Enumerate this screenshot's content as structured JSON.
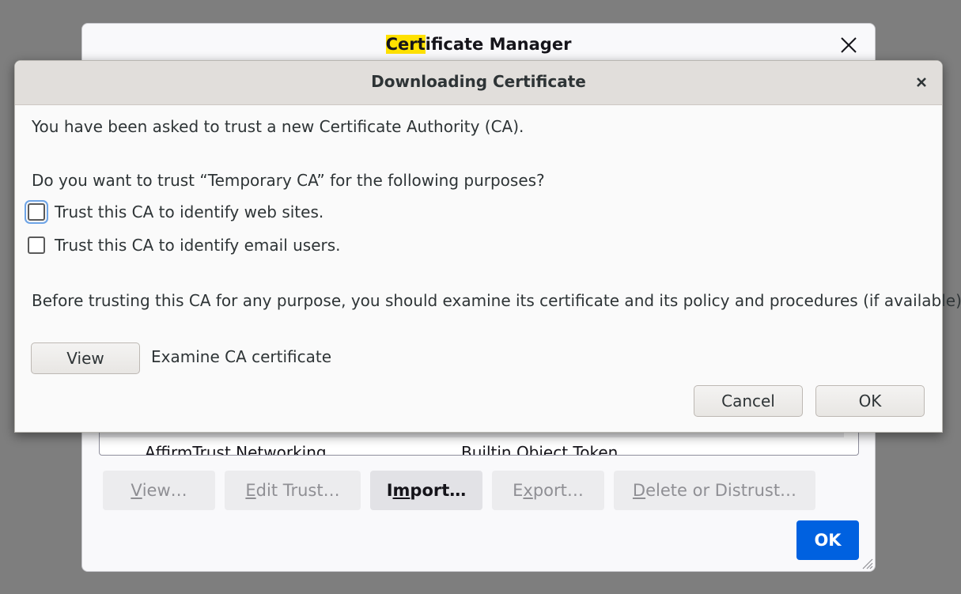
{
  "manager": {
    "title_highlight": "Cert",
    "title_rest": "ificate Manager",
    "tree_row": {
      "name": "AffirmTrust Networking",
      "token": "Builtin Object Token"
    },
    "buttons": {
      "view": {
        "mnemonic": "V",
        "rest": "iew…"
      },
      "edit_trust": {
        "mnemonic": "E",
        "rest": "dit Trust…"
      },
      "import": {
        "pre": "I",
        "mnemonic": "m",
        "rest": "port…"
      },
      "export": {
        "pre": "E",
        "mnemonic": "x",
        "rest": "port…"
      },
      "delete": {
        "mnemonic": "D",
        "rest": "elete or Distrust…"
      }
    },
    "ok_label": "OK"
  },
  "dialog": {
    "title": "Downloading Certificate",
    "intro": "You have been asked to trust a new Certificate Authority (CA).",
    "question": "Do you want to trust “Temporary CA” for the following purposes?",
    "trust_websites_label": "Trust this CA to identify web sites.",
    "trust_websites_checked": false,
    "trust_email_label": "Trust this CA to identify email users.",
    "trust_email_checked": false,
    "advice": "Before trusting this CA for any purpose, you should examine its certificate and its policy and procedures (if available).",
    "view_label": "View",
    "examine_label": "Examine CA certificate",
    "cancel_label": "Cancel",
    "ok_label": "OK"
  },
  "colors": {
    "accent": "#0061e0",
    "highlight": "#ffe100",
    "backdrop": "#7e7e7e"
  }
}
